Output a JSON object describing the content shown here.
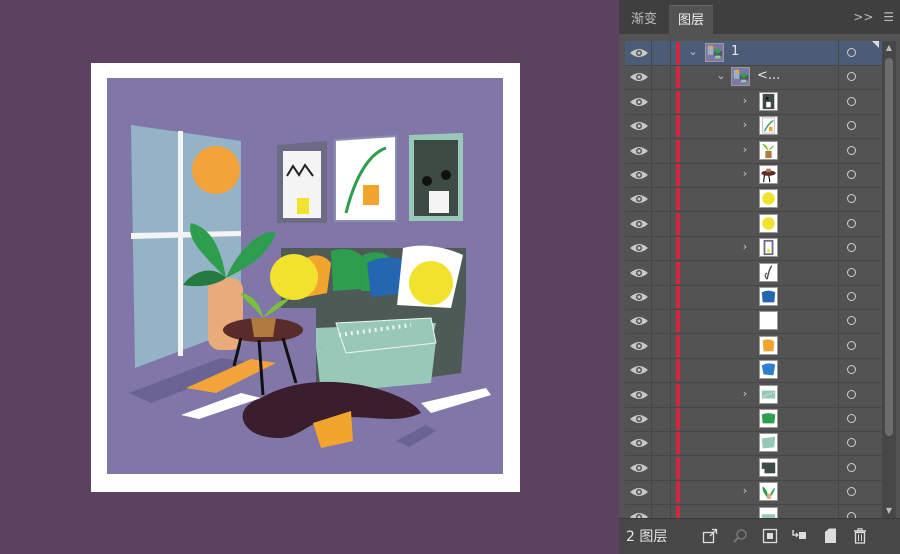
{
  "panel": {
    "tabs": [
      {
        "label": "渐变",
        "active": false
      },
      {
        "label": "图层",
        "active": true
      }
    ],
    "expand_label": ">>",
    "menu_icon": "menu-icon",
    "footer": {
      "layer_count": "2 图层"
    }
  },
  "layers": [
    {
      "name": "1",
      "expanded": true,
      "level": 0,
      "selected": true,
      "thumb": "scene"
    },
    {
      "name": "<...",
      "expanded": true,
      "level": 1,
      "selected": false,
      "thumb": "scene"
    },
    {
      "name": "",
      "expandable": true,
      "level": 2,
      "thumb": "dark-frame"
    },
    {
      "name": "",
      "expandable": true,
      "level": 2,
      "thumb": "leaf-frame"
    },
    {
      "name": "",
      "expandable": true,
      "level": 2,
      "thumb": "plant-pot"
    },
    {
      "name": "",
      "expandable": true,
      "level": 2,
      "thumb": "table"
    },
    {
      "name": "",
      "expandable": false,
      "level": 2,
      "thumb": "yellow-cushion"
    },
    {
      "name": "",
      "expandable": false,
      "level": 2,
      "thumb": "yellow-cushion"
    },
    {
      "name": "",
      "expandable": true,
      "level": 2,
      "thumb": "small-frame"
    },
    {
      "name": "",
      "expandable": false,
      "level": 2,
      "thumb": "green-leaf"
    },
    {
      "name": "",
      "expandable": false,
      "level": 2,
      "thumb": "blue-cushion"
    },
    {
      "name": "",
      "expandable": false,
      "level": 2,
      "thumb": "white"
    },
    {
      "name": "",
      "expandable": false,
      "level": 2,
      "thumb": "orange-cushion"
    },
    {
      "name": "",
      "expandable": false,
      "level": 2,
      "thumb": "blue-cushion2"
    },
    {
      "name": "",
      "expandable": true,
      "level": 2,
      "thumb": "mint-stripes"
    },
    {
      "name": "",
      "expandable": false,
      "level": 2,
      "thumb": "green-cushion"
    },
    {
      "name": "",
      "expandable": false,
      "level": 2,
      "thumb": "mint-shape"
    },
    {
      "name": "",
      "expandable": false,
      "level": 2,
      "thumb": "sofa"
    },
    {
      "name": "",
      "expandable": true,
      "level": 2,
      "thumb": "big-plant"
    },
    {
      "name": "",
      "expandable": false,
      "level": 2,
      "thumb": "stripe"
    }
  ],
  "colors": {
    "background": "#5b4360",
    "panel": "#535353",
    "layer_color": "#d5263e",
    "selection": "#4a5c76",
    "wall": "#8077a8",
    "window": "#94b3c6",
    "sun": "#f2a33a",
    "sofa": "#4e5a55",
    "mint": "#98c9b8",
    "yellow": "#f1e22e",
    "orange_cushion": "#f1a52d",
    "green_cushion": "#2c9e4d",
    "blue_cushion": "#2466b0",
    "rug": "#3b1e2d"
  }
}
